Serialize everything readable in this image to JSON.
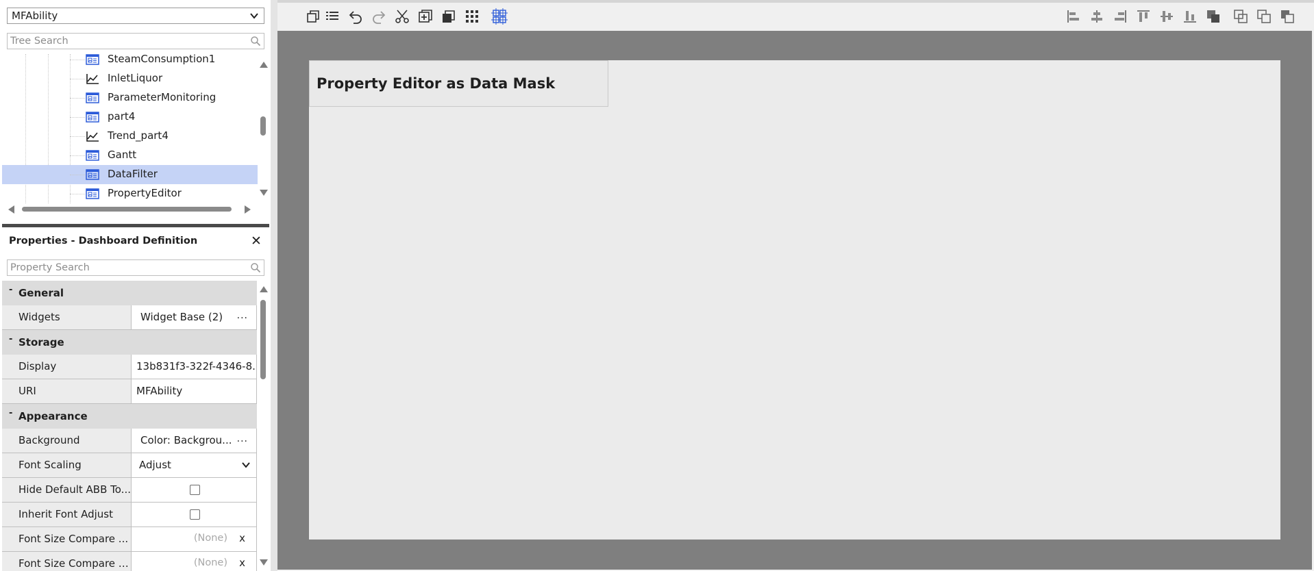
{
  "top_select": {
    "value": "MFAbility"
  },
  "tree_search": {
    "placeholder": "Tree Search"
  },
  "tree": {
    "items": [
      {
        "label": "SteamConsumption1",
        "icon": "dashboard-icon",
        "selected": false
      },
      {
        "label": "InletLiquor",
        "icon": "trend-chart-icon",
        "selected": false
      },
      {
        "label": "ParameterMonitoring",
        "icon": "dashboard-icon",
        "selected": false
      },
      {
        "label": "part4",
        "icon": "dashboard-icon",
        "selected": false
      },
      {
        "label": "Trend_part4",
        "icon": "trend-chart-icon",
        "selected": false
      },
      {
        "label": "Gantt",
        "icon": "dashboard-icon",
        "selected": false
      },
      {
        "label": "DataFilter",
        "icon": "dashboard-icon",
        "selected": true
      },
      {
        "label": "PropertyEditor",
        "icon": "dashboard-icon",
        "selected": false
      }
    ]
  },
  "properties": {
    "title": "Properties - Dashboard Definition",
    "close_label": "✕",
    "search_placeholder": "Property Search",
    "categories": {
      "general": {
        "minus": "-",
        "name": "General"
      },
      "storage": {
        "minus": "-",
        "name": "Storage"
      },
      "appearance": {
        "minus": "-",
        "name": "Appearance"
      }
    },
    "rows": {
      "widgets": {
        "name": "Widgets",
        "value": "Widget Base (2)",
        "action": "..."
      },
      "display": {
        "name": "Display",
        "value": "13b831f3-322f-4346-8..."
      },
      "uri": {
        "name": "URI",
        "value": "MFAbility"
      },
      "background": {
        "name": "Background",
        "value": "Color: Backgrou...",
        "action": "..."
      },
      "font_scaling": {
        "name": "Font Scaling",
        "value": "Adjust"
      },
      "hide_default": {
        "name": "Hide Default ABB To...",
        "checked": false
      },
      "inherit_font": {
        "name": "Inherit Font Adjust",
        "checked": false
      },
      "font_size_cmp1": {
        "name": "Font Size Compare ...",
        "value": "(None)",
        "clear": "x"
      },
      "font_size_cmp2": {
        "name": "Font Size Compare H...",
        "value": "(None)",
        "clear": "x"
      }
    }
  },
  "canvas": {
    "widget_title": "Property Editor as Data Mask"
  },
  "toolbar": {
    "left_tools": [
      "bring-to-front-icon",
      "list-icon",
      "undo-icon",
      "redo-icon",
      "cut-icon",
      "add-widget-icon",
      "duplicate-icon",
      "grid-dots-icon",
      "snap-grid-icon"
    ],
    "right_tools": [
      "align-left-icon",
      "align-center-icon",
      "align-right-icon",
      "align-top-icon",
      "align-middle-icon",
      "align-bottom-icon",
      "overlap-icon",
      "same-size-icon",
      "same-width-icon",
      "same-height-icon"
    ]
  },
  "colors": {
    "selection": "#c5d3f6",
    "icon_blue": "#2c5bd9",
    "stage": "#7f7f7f",
    "canvas": "#ebebeb"
  }
}
